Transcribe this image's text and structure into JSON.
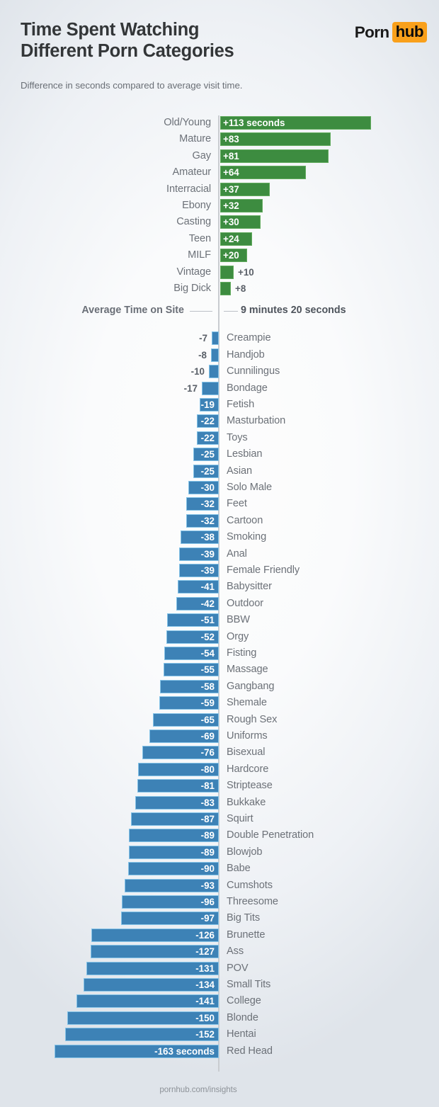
{
  "header": {
    "title_line1": "Time Spent Watching",
    "title_line2": "Different Porn Categories",
    "subtitle": "Difference in seconds compared to average visit time.",
    "logo_part1": "Porn",
    "logo_part2": "hub"
  },
  "average": {
    "left_label": "Average Time on Site",
    "value_label": "9 minutes 20 seconds"
  },
  "footer": {
    "source": "pornhub.com/insights"
  },
  "colors": {
    "positive_bar": "#3d8c40",
    "positive_bar_border": "#62ab5e",
    "negative_bar": "#3d82b6",
    "negative_bar_border": "#86c4e8",
    "axis_line": "#c9ccd0",
    "brand_orange": "#f9a01b",
    "label_text": "#6c7178"
  },
  "chart_data": {
    "type": "bar",
    "title": "Time Spent Watching Different Porn Categories",
    "subtitle": "Difference in seconds compared to average visit time.",
    "xlabel": "Difference in seconds compared to average visit time",
    "ylabel": "",
    "orientation": "horizontal",
    "baseline_label": "Average Time on Site",
    "baseline_value_text": "9 minutes 20 seconds",
    "baseline_value_seconds": 560,
    "unit": "seconds",
    "grid": false,
    "legend": "none",
    "xlim": [
      -163,
      113
    ],
    "categories": [
      "Old/Young",
      "Mature",
      "Gay",
      "Amateur",
      "Interracial",
      "Ebony",
      "Casting",
      "Teen",
      "MILF",
      "Vintage",
      "Big Dick",
      "Creampie",
      "Handjob",
      "Cunnilingus",
      "Bondage",
      "Fetish",
      "Masturbation",
      "Toys",
      "Lesbian",
      "Asian",
      "Solo Male",
      "Feet",
      "Cartoon",
      "Smoking",
      "Anal",
      "Female Friendly",
      "Babysitter",
      "Outdoor",
      "BBW",
      "Orgy",
      "Fisting",
      "Massage",
      "Gangbang",
      "Shemale",
      "Rough Sex",
      "Uniforms",
      "Bisexual",
      "Hardcore",
      "Striptease",
      "Bukkake",
      "Squirt",
      "Double Penetration",
      "Blowjob",
      "Babe",
      "Cumshots",
      "Threesome",
      "Big Tits",
      "Brunette",
      "Ass",
      "POV",
      "Small Tits",
      "College",
      "Blonde",
      "Hentai",
      "Red Head"
    ],
    "values": [
      113,
      83,
      81,
      64,
      37,
      32,
      30,
      24,
      20,
      10,
      8,
      -7,
      -8,
      -10,
      -17,
      -19,
      -22,
      -22,
      -25,
      -25,
      -30,
      -32,
      -32,
      -38,
      -39,
      -39,
      -41,
      -42,
      -51,
      -52,
      -54,
      -55,
      -58,
      -59,
      -65,
      -69,
      -76,
      -80,
      -81,
      -83,
      -87,
      -89,
      -89,
      -90,
      -93,
      -96,
      -97,
      -126,
      -127,
      -131,
      -134,
      -141,
      -150,
      -152,
      -163
    ],
    "bars": [
      {
        "label": "Old/Young",
        "value": 113,
        "value_text": "+113 seconds",
        "sign": "positive",
        "label_inside": true
      },
      {
        "label": "Mature",
        "value": 83,
        "value_text": "+83",
        "sign": "positive",
        "label_inside": true
      },
      {
        "label": "Gay",
        "value": 81,
        "value_text": "+81",
        "sign": "positive",
        "label_inside": true
      },
      {
        "label": "Amateur",
        "value": 64,
        "value_text": "+64",
        "sign": "positive",
        "label_inside": true
      },
      {
        "label": "Interracial",
        "value": 37,
        "value_text": "+37",
        "sign": "positive",
        "label_inside": true
      },
      {
        "label": "Ebony",
        "value": 32,
        "value_text": "+32",
        "sign": "positive",
        "label_inside": true
      },
      {
        "label": "Casting",
        "value": 30,
        "value_text": "+30",
        "sign": "positive",
        "label_inside": true
      },
      {
        "label": "Teen",
        "value": 24,
        "value_text": "+24",
        "sign": "positive",
        "label_inside": true
      },
      {
        "label": "MILF",
        "value": 20,
        "value_text": "+20",
        "sign": "positive",
        "label_inside": true
      },
      {
        "label": "Vintage",
        "value": 10,
        "value_text": "+10",
        "sign": "positive",
        "label_inside": false
      },
      {
        "label": "Big Dick",
        "value": 8,
        "value_text": "+8",
        "sign": "positive",
        "label_inside": false
      },
      {
        "label": "Creampie",
        "value": -7,
        "value_text": "-7",
        "sign": "negative",
        "label_inside": false
      },
      {
        "label": "Handjob",
        "value": -8,
        "value_text": "-8",
        "sign": "negative",
        "label_inside": false
      },
      {
        "label": "Cunnilingus",
        "value": -10,
        "value_text": "-10",
        "sign": "negative",
        "label_inside": false
      },
      {
        "label": "Bondage",
        "value": -17,
        "value_text": "-17",
        "sign": "negative",
        "label_inside": false
      },
      {
        "label": "Fetish",
        "value": -19,
        "value_text": "-19",
        "sign": "negative",
        "label_inside": true
      },
      {
        "label": "Masturbation",
        "value": -22,
        "value_text": "-22",
        "sign": "negative",
        "label_inside": true
      },
      {
        "label": "Toys",
        "value": -22,
        "value_text": "-22",
        "sign": "negative",
        "label_inside": true
      },
      {
        "label": "Lesbian",
        "value": -25,
        "value_text": "-25",
        "sign": "negative",
        "label_inside": true
      },
      {
        "label": "Asian",
        "value": -25,
        "value_text": "-25",
        "sign": "negative",
        "label_inside": true
      },
      {
        "label": "Solo Male",
        "value": -30,
        "value_text": "-30",
        "sign": "negative",
        "label_inside": true
      },
      {
        "label": "Feet",
        "value": -32,
        "value_text": "-32",
        "sign": "negative",
        "label_inside": true
      },
      {
        "label": "Cartoon",
        "value": -32,
        "value_text": "-32",
        "sign": "negative",
        "label_inside": true
      },
      {
        "label": "Smoking",
        "value": -38,
        "value_text": "-38",
        "sign": "negative",
        "label_inside": true
      },
      {
        "label": "Anal",
        "value": -39,
        "value_text": "-39",
        "sign": "negative",
        "label_inside": true
      },
      {
        "label": "Female Friendly",
        "value": -39,
        "value_text": "-39",
        "sign": "negative",
        "label_inside": true
      },
      {
        "label": "Babysitter",
        "value": -41,
        "value_text": "-41",
        "sign": "negative",
        "label_inside": true
      },
      {
        "label": "Outdoor",
        "value": -42,
        "value_text": "-42",
        "sign": "negative",
        "label_inside": true
      },
      {
        "label": "BBW",
        "value": -51,
        "value_text": "-51",
        "sign": "negative",
        "label_inside": true
      },
      {
        "label": "Orgy",
        "value": -52,
        "value_text": "-52",
        "sign": "negative",
        "label_inside": true
      },
      {
        "label": "Fisting",
        "value": -54,
        "value_text": "-54",
        "sign": "negative",
        "label_inside": true
      },
      {
        "label": "Massage",
        "value": -55,
        "value_text": "-55",
        "sign": "negative",
        "label_inside": true
      },
      {
        "label": "Gangbang",
        "value": -58,
        "value_text": "-58",
        "sign": "negative",
        "label_inside": true
      },
      {
        "label": "Shemale",
        "value": -59,
        "value_text": "-59",
        "sign": "negative",
        "label_inside": true
      },
      {
        "label": "Rough Sex",
        "value": -65,
        "value_text": "-65",
        "sign": "negative",
        "label_inside": true
      },
      {
        "label": "Uniforms",
        "value": -69,
        "value_text": "-69",
        "sign": "negative",
        "label_inside": true
      },
      {
        "label": "Bisexual",
        "value": -76,
        "value_text": "-76",
        "sign": "negative",
        "label_inside": true
      },
      {
        "label": "Hardcore",
        "value": -80,
        "value_text": "-80",
        "sign": "negative",
        "label_inside": true
      },
      {
        "label": "Striptease",
        "value": -81,
        "value_text": "-81",
        "sign": "negative",
        "label_inside": true
      },
      {
        "label": "Bukkake",
        "value": -83,
        "value_text": "-83",
        "sign": "negative",
        "label_inside": true
      },
      {
        "label": "Squirt",
        "value": -87,
        "value_text": "-87",
        "sign": "negative",
        "label_inside": true
      },
      {
        "label": "Double Penetration",
        "value": -89,
        "value_text": "-89",
        "sign": "negative",
        "label_inside": true
      },
      {
        "label": "Blowjob",
        "value": -89,
        "value_text": "-89",
        "sign": "negative",
        "label_inside": true
      },
      {
        "label": "Babe",
        "value": -90,
        "value_text": "-90",
        "sign": "negative",
        "label_inside": true
      },
      {
        "label": "Cumshots",
        "value": -93,
        "value_text": "-93",
        "sign": "negative",
        "label_inside": true
      },
      {
        "label": "Threesome",
        "value": -96,
        "value_text": "-96",
        "sign": "negative",
        "label_inside": true
      },
      {
        "label": "Big Tits",
        "value": -97,
        "value_text": "-97",
        "sign": "negative",
        "label_inside": true
      },
      {
        "label": "Brunette",
        "value": -126,
        "value_text": "-126",
        "sign": "negative",
        "label_inside": true
      },
      {
        "label": "Ass",
        "value": -127,
        "value_text": "-127",
        "sign": "negative",
        "label_inside": true
      },
      {
        "label": "POV",
        "value": -131,
        "value_text": "-131",
        "sign": "negative",
        "label_inside": true
      },
      {
        "label": "Small Tits",
        "value": -134,
        "value_text": "-134",
        "sign": "negative",
        "label_inside": true
      },
      {
        "label": "College",
        "value": -141,
        "value_text": "-141",
        "sign": "negative",
        "label_inside": true
      },
      {
        "label": "Blonde",
        "value": -150,
        "value_text": "-150",
        "sign": "negative",
        "label_inside": true
      },
      {
        "label": "Hentai",
        "value": -152,
        "value_text": "-152",
        "sign": "negative",
        "label_inside": true
      },
      {
        "label": "Red Head",
        "value": -163,
        "value_text": "-163 seconds",
        "sign": "negative",
        "label_inside": true
      }
    ]
  }
}
